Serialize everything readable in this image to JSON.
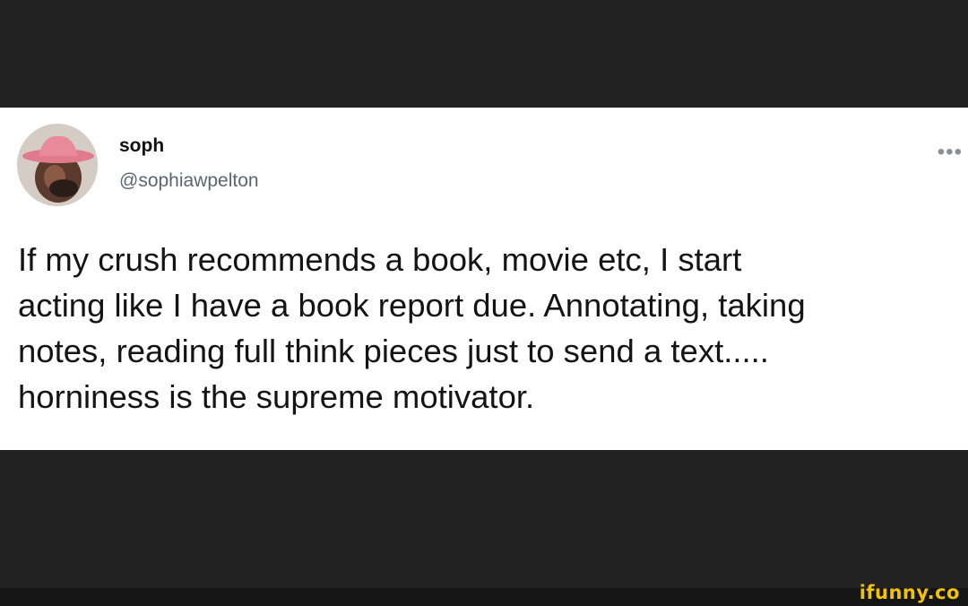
{
  "tweet": {
    "display_name": "soph",
    "handle": "@sophiawpelton",
    "more_icon": "ellipsis-icon",
    "avatar_icon": "user-avatar",
    "text": "If my crush recommends a book, movie etc, I start\nacting like I have a book report due. Annotating, taking\nnotes, reading full think pieces just to send a text.....\nhorniness is the supreme motivator."
  },
  "watermark": {
    "text": "ifunny.co"
  },
  "colors": {
    "background": "#222222",
    "card": "#ffffff",
    "text": "#141414",
    "handle": "#5b6670",
    "watermark": "#f2c400"
  }
}
